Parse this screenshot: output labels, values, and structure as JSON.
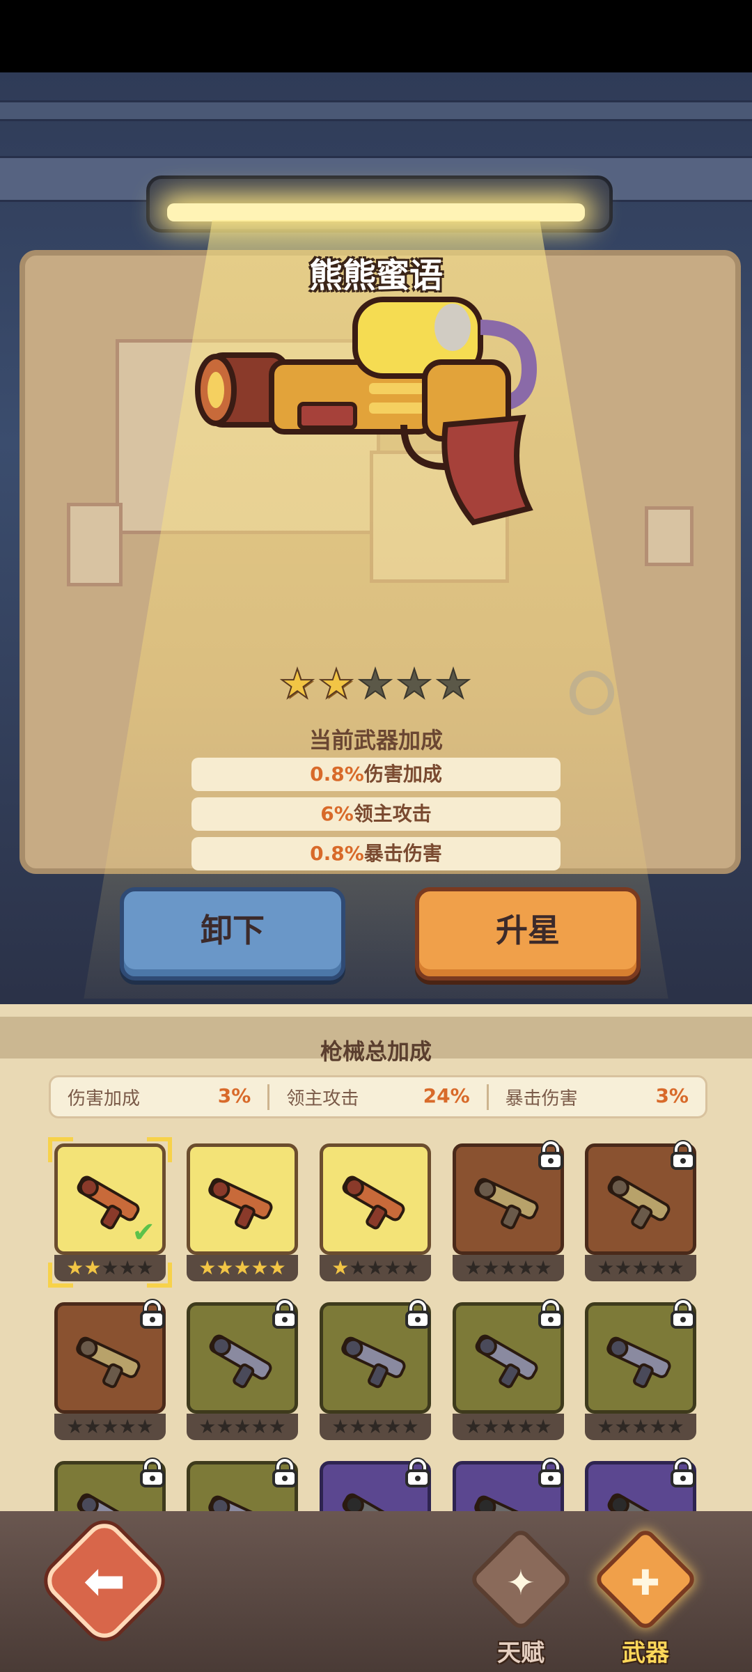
{
  "weapon": {
    "name": "熊熊蜜语",
    "stars_filled": 2,
    "stars_total": 5,
    "bonus_title": "当前武器加成",
    "bonuses": [
      {
        "value": "0.8%",
        "label": "伤害加成"
      },
      {
        "value": "6%",
        "label": "领主攻击"
      },
      {
        "value": "0.8%",
        "label": "暴击伤害"
      }
    ]
  },
  "actions": {
    "unequip_label": "卸下",
    "upgrade_label": "升星"
  },
  "totals": {
    "title": "枪械总加成",
    "items": [
      {
        "label": "伤害加成",
        "value": "3%"
      },
      {
        "label": "领主攻击",
        "value": "24%"
      },
      {
        "label": "暴击伤害",
        "value": "3%"
      }
    ]
  },
  "inventory": [
    {
      "rarity": "gold",
      "stars": 2,
      "locked": false,
      "selected": true,
      "icon": "honey-water-gun-icon"
    },
    {
      "rarity": "gold",
      "stars": 5,
      "locked": false,
      "selected": false,
      "icon": "teddy-bear-gun-icon"
    },
    {
      "rarity": "gold",
      "stars": 1,
      "locked": false,
      "selected": false,
      "icon": "candy-blaster-icon"
    },
    {
      "rarity": "brown",
      "stars": 0,
      "locked": true,
      "selected": false,
      "icon": "crystal-rifle-icon"
    },
    {
      "rarity": "brown",
      "stars": 0,
      "locked": true,
      "selected": false,
      "icon": "demon-blade-gun-icon"
    },
    {
      "rarity": "brown",
      "stars": 0,
      "locked": true,
      "selected": false,
      "icon": "bone-cannon-icon"
    },
    {
      "rarity": "olive",
      "stars": 0,
      "locked": true,
      "selected": false,
      "icon": "dragon-crossbow-icon"
    },
    {
      "rarity": "olive",
      "stars": 0,
      "locked": true,
      "selected": false,
      "icon": "heavy-rifle-icon"
    },
    {
      "rarity": "olive",
      "stars": 0,
      "locked": true,
      "selected": false,
      "icon": "steam-pistol-icon"
    },
    {
      "rarity": "olive",
      "stars": 0,
      "locked": true,
      "selected": false,
      "icon": "laser-blaster-icon"
    },
    {
      "rarity": "olive",
      "stars": 0,
      "locked": true,
      "selected": false,
      "icon": "ice-shard-gun-icon"
    },
    {
      "rarity": "olive",
      "stars": 0,
      "locked": true,
      "selected": false,
      "icon": "bazooka-icon"
    },
    {
      "rarity": "purple",
      "stars": 0,
      "locked": true,
      "selected": false,
      "icon": "gatling-gun-icon"
    },
    {
      "rarity": "purple",
      "stars": 0,
      "locked": true,
      "selected": false,
      "icon": "plasma-rifle-icon"
    },
    {
      "rarity": "purple",
      "stars": 0,
      "locked": true,
      "selected": false,
      "icon": "sniper-rifle-icon"
    }
  ],
  "nav": {
    "back_icon": "back-arrow-icon",
    "tabs": [
      {
        "label": "天赋",
        "icon": "talent-emblem-icon",
        "active": false
      },
      {
        "label": "武器",
        "icon": "weapon-gun-icon",
        "active": true
      }
    ]
  },
  "colors": {
    "accent_orange": "#d86a2a",
    "star_gold": "#f2c545",
    "unequip_blue": "#6a97c8",
    "upgrade_orange": "#f0a04a"
  }
}
